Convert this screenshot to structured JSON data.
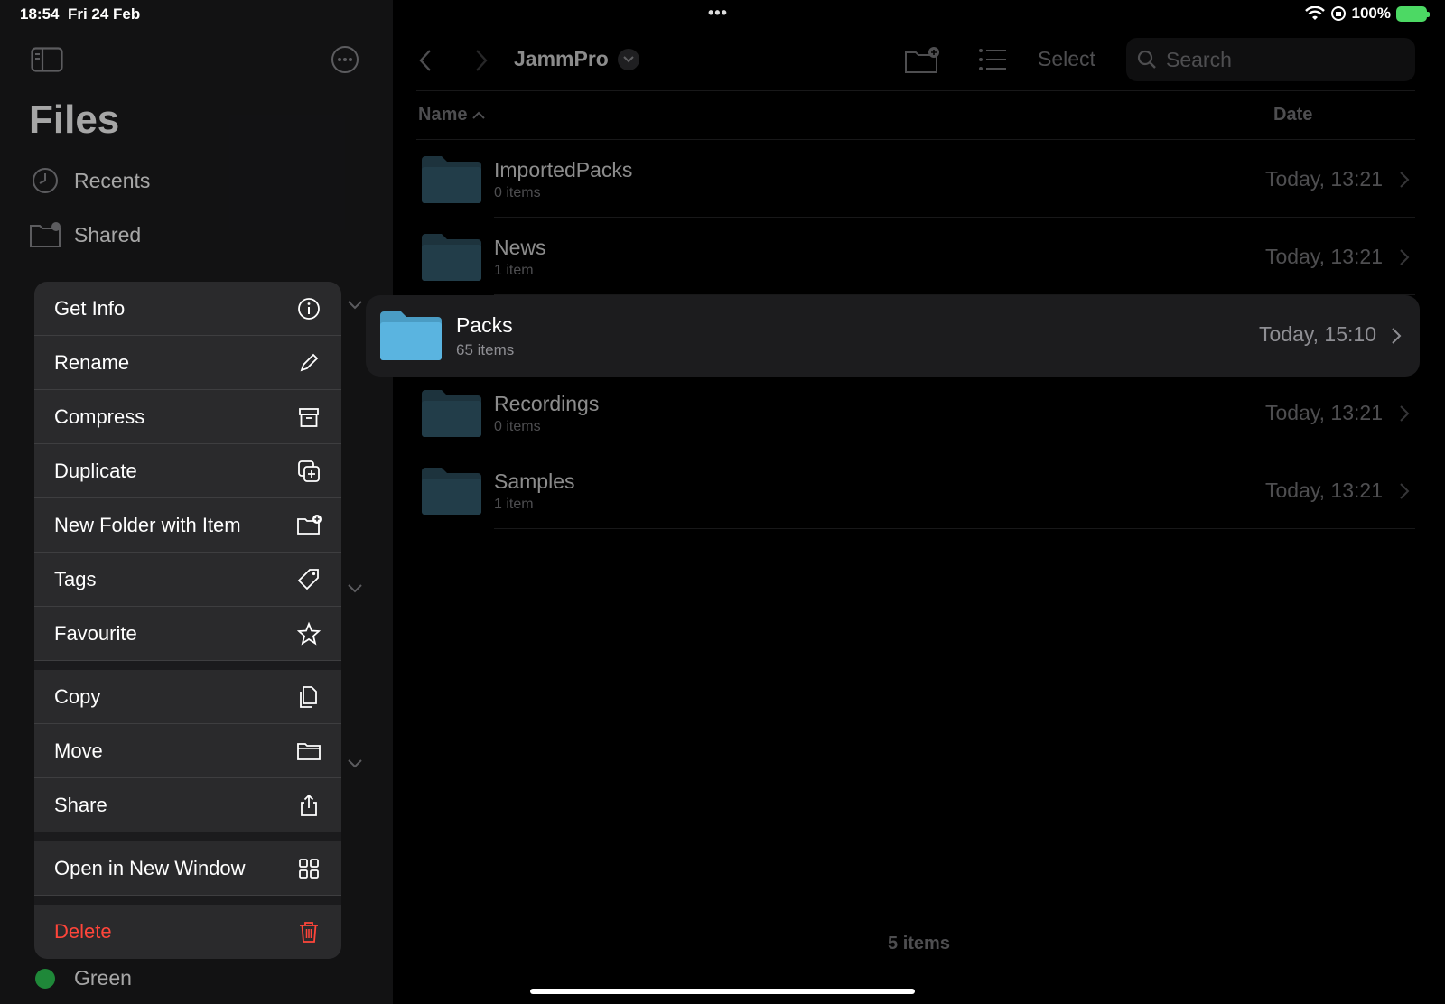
{
  "status": {
    "time": "18:54",
    "date": "Fri 24 Feb",
    "battery": "100%",
    "dots": "•••"
  },
  "sidebar": {
    "title": "Files",
    "items": [
      {
        "label": "Recents",
        "icon": "clock-icon"
      },
      {
        "label": "Shared",
        "icon": "shared-folder-icon"
      }
    ],
    "tag_green": "Green"
  },
  "toolbar": {
    "folder_title": "JammPro",
    "select_label": "Select",
    "search_placeholder": "Search"
  },
  "columns": {
    "name": "Name",
    "date": "Date"
  },
  "files": [
    {
      "name": "ImportedPacks",
      "sub": "0 items",
      "date": "Today, 13:21"
    },
    {
      "name": "News",
      "sub": "1 item",
      "date": "Today, 13:21"
    },
    {
      "name": "Packs",
      "sub": "65 items",
      "date": "Today, 15:10",
      "selected": true
    },
    {
      "name": "Recordings",
      "sub": "0 items",
      "date": "Today, 13:21"
    },
    {
      "name": "Samples",
      "sub": "1 item",
      "date": "Today, 13:21"
    }
  ],
  "footer": {
    "count": "5 items"
  },
  "menu": {
    "group1": [
      {
        "label": "Get Info",
        "icon": "info-icon"
      },
      {
        "label": "Rename",
        "icon": "pencil-icon"
      },
      {
        "label": "Compress",
        "icon": "archive-box-icon"
      },
      {
        "label": "Duplicate",
        "icon": "duplicate-icon"
      },
      {
        "label": "New Folder with Item",
        "icon": "folder-plus-icon"
      },
      {
        "label": "Tags",
        "icon": "tag-icon"
      },
      {
        "label": "Favourite",
        "icon": "star-icon"
      }
    ],
    "group2": [
      {
        "label": "Copy",
        "icon": "copy-icon"
      },
      {
        "label": "Move",
        "icon": "folder-icon"
      },
      {
        "label": "Share",
        "icon": "share-icon"
      }
    ],
    "group3": [
      {
        "label": "Open in New Window",
        "icon": "grid-icon"
      }
    ],
    "group4": [
      {
        "label": "Delete",
        "icon": "trash-icon"
      }
    ]
  },
  "colors": {
    "accent": "#0a84ff",
    "danger": "#ff453a",
    "folder_selected": "#5ab4e0",
    "folder_dim": "#3f6f86"
  }
}
